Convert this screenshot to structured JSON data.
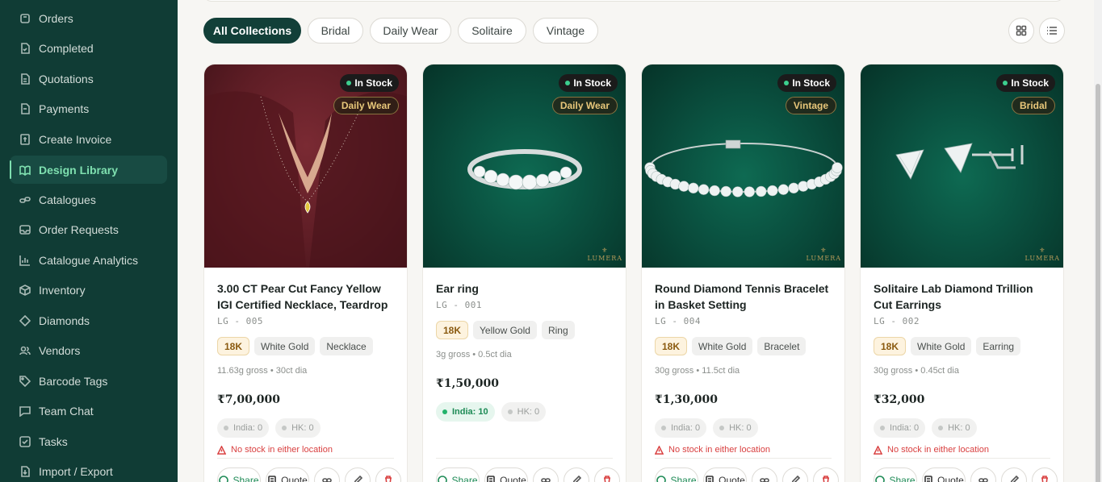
{
  "sidebar": {
    "items": [
      {
        "label": "Orders",
        "icon": "box-icon"
      },
      {
        "label": "Completed",
        "icon": "check-file-icon"
      },
      {
        "label": "Quotations",
        "icon": "file-icon"
      },
      {
        "label": "Payments",
        "icon": "card-icon"
      },
      {
        "label": "Create Invoice",
        "icon": "invoice-icon"
      },
      {
        "label": "Design Library",
        "icon": "book-icon",
        "active": true
      },
      {
        "label": "Catalogues",
        "icon": "link-icon"
      },
      {
        "label": "Order Requests",
        "icon": "inbox-icon"
      },
      {
        "label": "Catalogue Analytics",
        "icon": "chart-icon"
      },
      {
        "label": "Inventory",
        "icon": "cube-icon"
      },
      {
        "label": "Diamonds",
        "icon": "diamond-icon"
      },
      {
        "label": "Vendors",
        "icon": "users-icon"
      },
      {
        "label": "Barcode Tags",
        "icon": "tag-icon"
      },
      {
        "label": "Team Chat",
        "icon": "chat-icon"
      },
      {
        "label": "Tasks",
        "icon": "checkbox-icon"
      },
      {
        "label": "Import / Export",
        "icon": "import-icon"
      }
    ]
  },
  "filters": {
    "pills": [
      "All Collections",
      "Bridal",
      "Daily Wear",
      "Solitaire",
      "Vintage"
    ],
    "active": "All Collections"
  },
  "cards": [
    {
      "title": "3.00 CT Pear Cut Fancy Yellow IGI Certified Necklace, Teardrop Ha…",
      "sku": "LG - 005",
      "stock_badge": "In Stock",
      "category": "Daily Wear",
      "karat": "18K",
      "metal": "White Gold",
      "type": "Necklace",
      "weight": "11.63g gross • 30ct dia",
      "price": "₹7,00,000",
      "india": "India: 0",
      "hk": "HK: 0",
      "warning": "No stock in either location",
      "share": "Share",
      "quote": "Quote"
    },
    {
      "title": "Ear ring",
      "sku": "LG - 001",
      "stock_badge": "In Stock",
      "category": "Daily Wear",
      "karat": "18K",
      "metal": "Yellow Gold",
      "type": "Ring",
      "weight": "3g gross • 0.5ct dia",
      "price": "₹1,50,000",
      "india": "India: 10",
      "hk": "HK: 0",
      "share": "Share",
      "quote": "Quote"
    },
    {
      "title": "Round Diamond Tennis Bracelet in Basket Setting",
      "sku": "LG - 004",
      "stock_badge": "In Stock",
      "category": "Vintage",
      "karat": "18K",
      "metal": "White Gold",
      "type": "Bracelet",
      "weight": "30g gross • 11.5ct dia",
      "price": "₹1,30,000",
      "india": "India: 0",
      "hk": "HK: 0",
      "warning": "No stock in either location",
      "share": "Share",
      "quote": "Quote"
    },
    {
      "title": "Solitaire Lab Diamond Trillion Cut Earrings",
      "sku": "LG - 002",
      "stock_badge": "In Stock",
      "category": "Bridal",
      "karat": "18K",
      "metal": "White Gold",
      "type": "Earring",
      "weight": "30g gross • 0.45ct dia",
      "price": "₹32,000",
      "india": "India: 0",
      "hk": "HK: 0",
      "warning": "No stock in either location",
      "share": "Share",
      "quote": "Quote"
    }
  ],
  "brand_mark": "LUMERA",
  "colors": {
    "sidebar": "#103c35",
    "accent": "#7fe0b0",
    "active_pill": "#123f38",
    "warning": "#d94040"
  }
}
